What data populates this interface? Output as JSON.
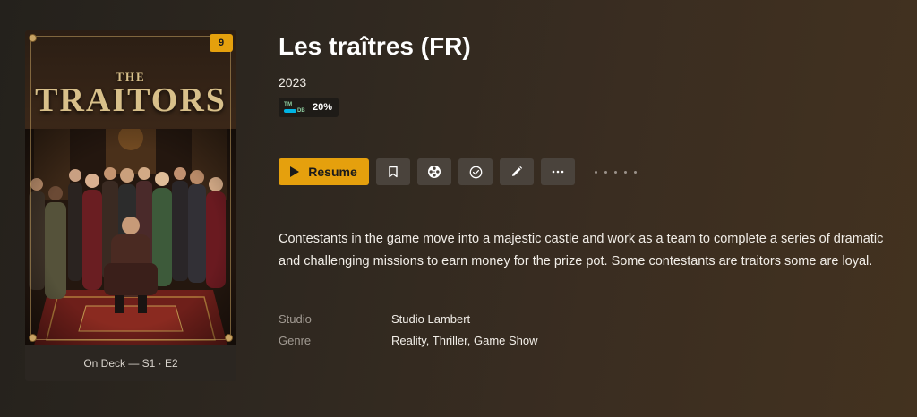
{
  "poster": {
    "title_small": "THE",
    "title_big": "TRAITORS",
    "unwatched_count": "9",
    "on_deck": "On Deck — S1 · E2"
  },
  "show": {
    "title": "Les traîtres (FR)",
    "year": "2023",
    "rating": {
      "source_icon": "tmdb-icon",
      "logo_top": "TM",
      "logo_bottom": "DB",
      "value": "20%"
    },
    "summary": "Contestants in the game move into a majestic castle and work as a team to complete a series of dramatic and challenging missions to earn money for the prize pot. Some contestants are traitors some are loyal.",
    "metadata": [
      {
        "label": "Studio",
        "value": "Studio Lambert"
      },
      {
        "label": "Genre",
        "value": "Reality, Thriller, Game Show"
      }
    ]
  },
  "actions": {
    "resume_label": "Resume",
    "icons": [
      "bookmark-icon",
      "film-reel-icon",
      "checkmark-icon",
      "pencil-icon",
      "more-icon"
    ]
  },
  "colors": {
    "accent": "#e5a00d",
    "button_bg": "#4a433c",
    "background_start": "#24211c",
    "background_end": "#43321f"
  }
}
